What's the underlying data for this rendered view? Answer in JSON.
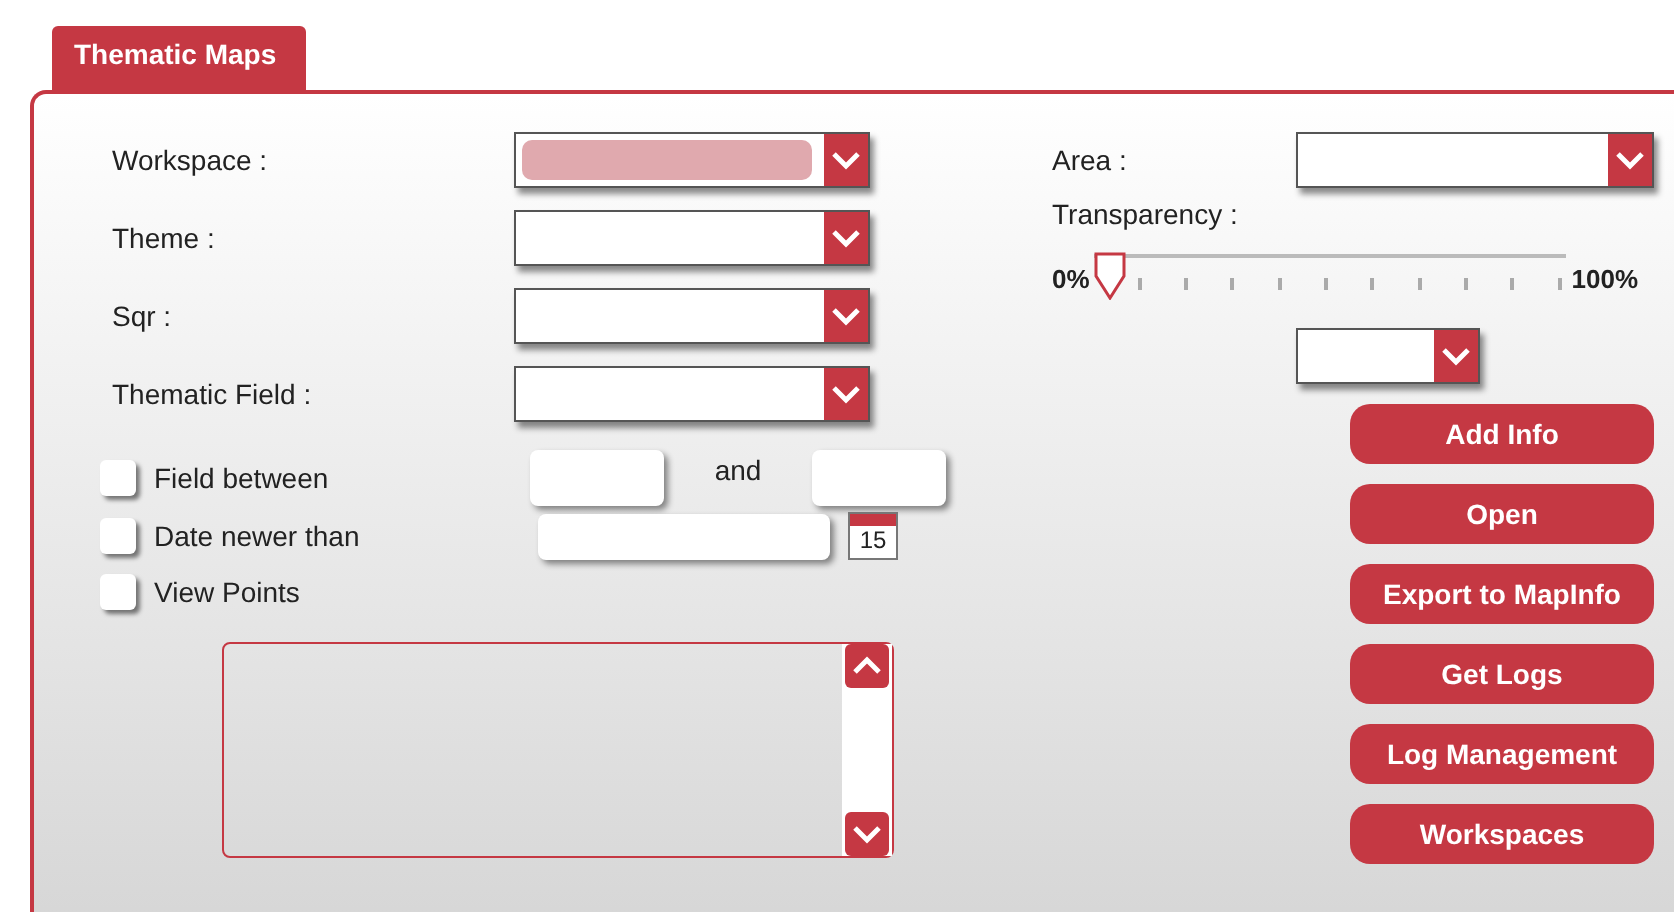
{
  "tabs": [
    {
      "label": "Thematic Maps",
      "selected": true
    }
  ],
  "left_fields": [
    {
      "label": "Workspace :",
      "highlighted": true
    },
    {
      "label": "Theme :",
      "highlighted": false
    },
    {
      "label": "Sqr :",
      "highlighted": false
    },
    {
      "label": "Thematic Field :",
      "highlighted": false
    }
  ],
  "filters": [
    {
      "kind": "range",
      "label": "Field between",
      "checked": false,
      "joiner": "and"
    },
    {
      "kind": "date",
      "label": "Date newer than",
      "checked": false,
      "calendar_day": "15"
    },
    {
      "kind": "plain",
      "label": "View Points",
      "checked": false
    }
  ],
  "area": {
    "label": "Area :"
  },
  "transparency": {
    "label": "Transparency :",
    "min_label": "0%",
    "max_label": "100%",
    "level": 0
  },
  "buttons": [
    "Add Info",
    "Open",
    "Export to MapInfo",
    "Get Logs",
    "Log Management",
    "Workspaces"
  ]
}
